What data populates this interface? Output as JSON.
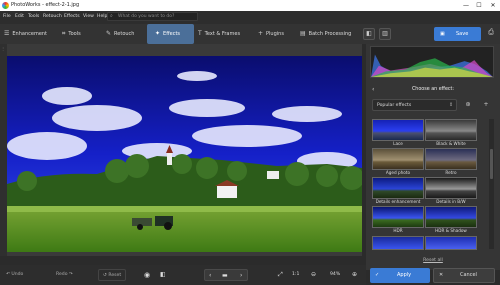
{
  "window": {
    "title": "PhotoWorks - effect-2-1.jpg",
    "minimize": "—",
    "maximize": "☐",
    "close": "✕"
  },
  "menu": [
    "File",
    "Edit",
    "Tools",
    "Retouch",
    "Effects",
    "View",
    "Help"
  ],
  "search": {
    "placeholder": "What do you want to do?",
    "icon": "search-icon"
  },
  "toolbar": {
    "tabs": [
      {
        "label": "Enhancement",
        "icon": "sliders-icon"
      },
      {
        "label": "Tools",
        "icon": "crop-icon"
      },
      {
        "label": "Retouch",
        "icon": "brush-icon"
      },
      {
        "label": "Effects",
        "icon": "magic-wand-icon"
      },
      {
        "label": "Text & Frames",
        "icon": "text-icon"
      },
      {
        "label": "Plugins",
        "icon": "plus-icon"
      },
      {
        "label": "Batch Processing",
        "icon": "batch-icon"
      }
    ],
    "active_tab": "Effects"
  },
  "rightbar": {
    "save_label": "Save"
  },
  "panel": {
    "choose_title": "Choose an effect:",
    "dropdown_value": "Popular effects",
    "effects": [
      {
        "label": "Lace"
      },
      {
        "label": "Black & White"
      },
      {
        "label": "Aged photo"
      },
      {
        "label": "Retro"
      },
      {
        "label": "Details enhancement"
      },
      {
        "label": "Details in B/W"
      },
      {
        "label": "HDR"
      },
      {
        "label": "HDR & Shadow"
      },
      {
        "label": ""
      },
      {
        "label": ""
      }
    ],
    "reset_all": "Reset all"
  },
  "bottombar": {
    "undo": "Undo",
    "redo": "Redo",
    "reset": "Reset",
    "ratio": "1:1",
    "zoom": "94%"
  },
  "buttons": {
    "apply": "Apply",
    "cancel": "Cancel"
  },
  "colors": {
    "accent": "#3a7bd5",
    "active_tab": "#4b6f99",
    "panel": "#353535",
    "background": "#2b2b2b"
  }
}
